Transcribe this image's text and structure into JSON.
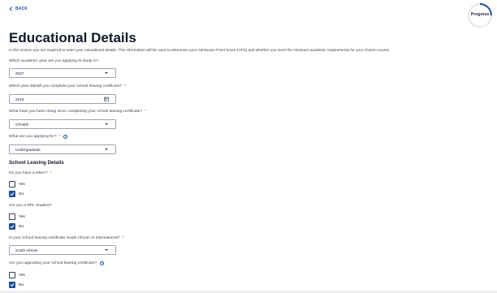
{
  "nav": {
    "back_label": "BACK"
  },
  "progress": {
    "label": "Progress",
    "fraction": 0.25,
    "track_color": "#e5e7eb",
    "fill_color": "#1e4f9c"
  },
  "page": {
    "title": "Educational Details",
    "intro": "In this section you are required to enter your educational details. This information will be used to determine your Admission Point Score (APS) and whether you meet the minimum academic requirements for your chosen course."
  },
  "form": {
    "academic_year": {
      "question": "Which academic year are you applying to study in?",
      "value": "2027"
    },
    "completion_year": {
      "question": "Which year did/will you complete your school leaving certificate?",
      "required": "*",
      "value": "2018",
      "icon": "calendar-icon"
    },
    "activity": {
      "question": "What have you been doing since completing your school leaving certificate?",
      "required": "*",
      "value": "OTHER"
    },
    "applying_for": {
      "question": "What are you applying for?",
      "required": "*",
      "help": "?",
      "value": "Undergraduate"
    }
  },
  "school_leaving": {
    "heading": "School Leaving Details",
    "token": {
      "question": "Do you have a token?",
      "required": "*",
      "yes": "Yes",
      "no": "No",
      "selected": "No"
    },
    "rpl": {
      "question": "Are you a RPL Student?",
      "yes": "Yes",
      "no": "No",
      "selected": "No"
    },
    "certificate_type": {
      "question": "Is your school leaving certificate South African or International?",
      "required": "*",
      "value": "South African"
    },
    "upgrading": {
      "question": "Are you upgrading your school leaving certificate?",
      "help": "?",
      "yes": "Yes",
      "no": "No",
      "selected": "No"
    }
  },
  "colors": {
    "accent": "#1e4f9c",
    "required": "#dc2626"
  }
}
